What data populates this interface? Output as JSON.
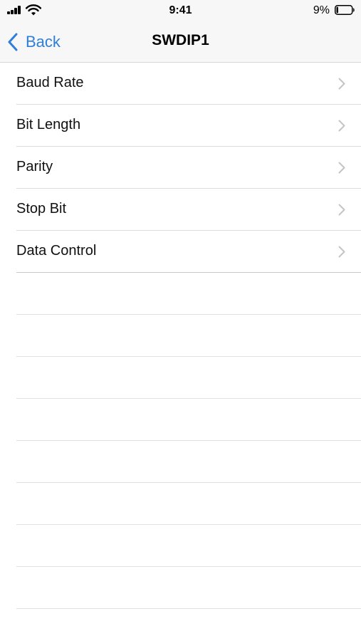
{
  "status_bar": {
    "time": "9:41",
    "battery_percent": "9%",
    "battery_level": 0.09
  },
  "nav": {
    "back_label": "Back",
    "title": "SWDIP1"
  },
  "settings": {
    "items": [
      {
        "label": "Baud Rate"
      },
      {
        "label": "Bit Length"
      },
      {
        "label": "Parity"
      },
      {
        "label": "Stop Bit"
      },
      {
        "label": "Data Control"
      }
    ]
  },
  "colors": {
    "accent": "#2f7fd8",
    "chevron": "#c4c4c7",
    "separator": "#dcdcdc",
    "bar_background": "#f7f7f7"
  },
  "icons": {
    "back": "chevron-left-icon",
    "disclosure": "chevron-right-icon",
    "signal": "cellular-signal-icon",
    "wifi": "wifi-icon",
    "battery": "battery-icon"
  }
}
